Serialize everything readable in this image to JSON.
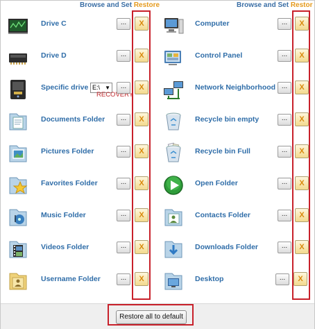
{
  "headers": {
    "left": {
      "browse": "Browse and Set",
      "restore": "Restore"
    },
    "right": {
      "browse": "Browse and Set",
      "restore": "Restor"
    }
  },
  "buttons": {
    "browse": "...",
    "restore": "X"
  },
  "left_rows": [
    {
      "label": "Drive C",
      "icon": "drive-c-icon"
    },
    {
      "label": "Drive D",
      "icon": "drive-d-icon"
    },
    {
      "label": "Specific drive",
      "icon": "specific-drive-icon"
    },
    {
      "label": "Documents Folder",
      "icon": "documents-folder-icon"
    },
    {
      "label": "Pictures Folder",
      "icon": "pictures-folder-icon"
    },
    {
      "label": "Favorites Folder",
      "icon": "favorites-folder-icon"
    },
    {
      "label": "Music Folder",
      "icon": "music-folder-icon"
    },
    {
      "label": "Videos Folder",
      "icon": "videos-folder-icon"
    },
    {
      "label": "Username Folder",
      "icon": "username-folder-icon"
    }
  ],
  "right_rows": [
    {
      "label": "Computer",
      "icon": "computer-icon"
    },
    {
      "label": "Control Panel",
      "icon": "control-panel-icon"
    },
    {
      "label": "Network Neighborhood",
      "icon": "network-icon"
    },
    {
      "label": "Recycle bin empty",
      "icon": "recycle-bin-empty-icon"
    },
    {
      "label": "Recycle bin Full",
      "icon": "recycle-bin-full-icon"
    },
    {
      "label": "Open Folder",
      "icon": "open-folder-icon"
    },
    {
      "label": "Contacts Folder",
      "icon": "contacts-folder-icon"
    },
    {
      "label": "Downloads Folder",
      "icon": "downloads-folder-icon"
    },
    {
      "label": "Desktop",
      "icon": "desktop-icon"
    }
  ],
  "specific_drive": {
    "value": "E:\\",
    "recovery": "RECOVERY"
  },
  "footer": {
    "reset_label": "Restore all to default"
  },
  "colors": {
    "label": "#2f6da8",
    "restore_header": "#e59a1c",
    "highlight_box": "#c8202a"
  }
}
